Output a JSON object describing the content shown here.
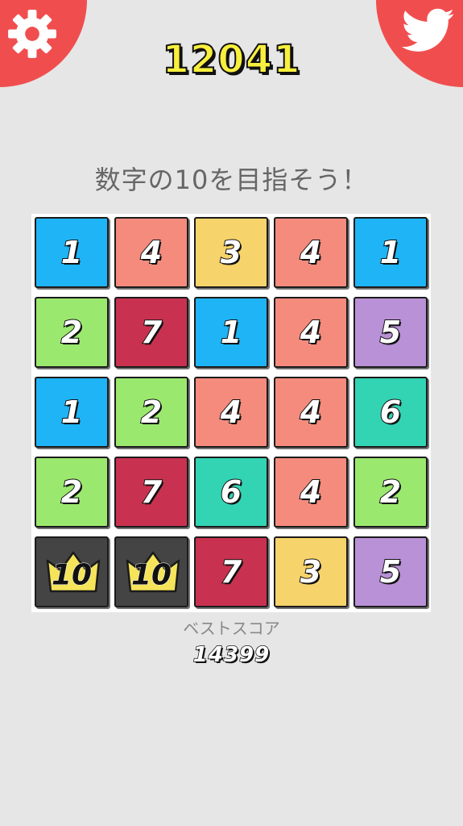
{
  "header": {
    "score": "12041",
    "settings_icon": "gear-icon",
    "share_icon": "twitter-bird-icon",
    "accent_color": "#f04e4e",
    "score_color": "#f8ef3e"
  },
  "instruction": "数字の10を目指そう！",
  "board": {
    "rows": [
      [
        "1",
        "4",
        "3",
        "4",
        "1"
      ],
      [
        "2",
        "7",
        "1",
        "4",
        "5"
      ],
      [
        "1",
        "2",
        "4",
        "4",
        "6"
      ],
      [
        "2",
        "7",
        "6",
        "4",
        "2"
      ],
      [
        "10",
        "10",
        "7",
        "3",
        "5"
      ]
    ]
  },
  "tile_colors": {
    "1": "#1fb4f5",
    "2": "#9be86f",
    "3": "#f7d36b",
    "4": "#f48b7d",
    "5": "#b991d6",
    "6": "#33d4b4",
    "7": "#c83250",
    "10": "#444444"
  },
  "best": {
    "label": "ベストスコア",
    "score": "14399"
  }
}
